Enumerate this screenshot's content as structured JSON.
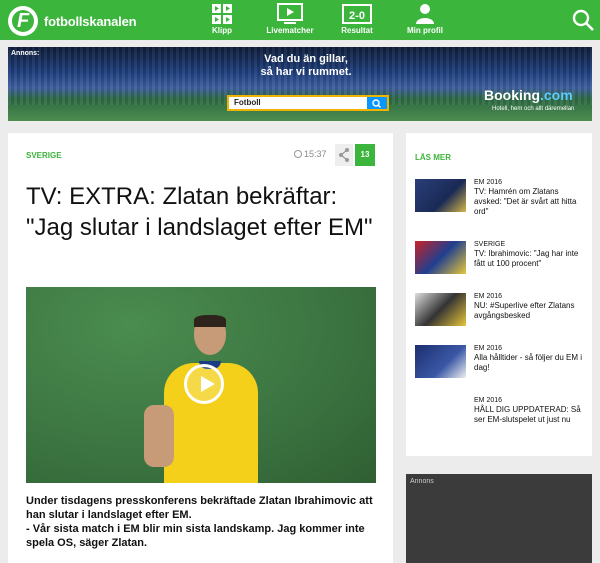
{
  "header": {
    "logo_text": "fotbollskanalen",
    "nav": [
      {
        "label": "Klipp",
        "icon": "grid-icon"
      },
      {
        "label": "Livematcher",
        "icon": "tv-icon"
      },
      {
        "label": "Resultat",
        "icon": "scoreboard-icon"
      },
      {
        "label": "Min profil",
        "icon": "user-icon"
      }
    ],
    "scoreboard_text": "2-0",
    "search_icon": "search-icon",
    "color_brand": "#3bb53b"
  },
  "ad_banner": {
    "label": "Annons:",
    "tagline_line1": "Vad du än gillar,",
    "tagline_line2": "så har vi rummet.",
    "search_value": "Fotboll",
    "brand_main": "Booking",
    "brand_suffix": ".com",
    "brand_sub": "Hotell, hem och allt däremellan"
  },
  "article": {
    "category": "SVERIGE",
    "time": "15:37",
    "share_count": "13",
    "headline": "TV: EXTRA: Zlatan bekräftar: \"Jag slutar i landslaget efter EM\"",
    "lead_p1": "Under tisdagens presskonferens bekräftade Zlatan Ibrahimovic att han slutar i landslaget efter EM.",
    "lead_p2": "- Vår sista match i EM blir min sista landskamp. Jag kommer inte spela OS, säger Zlatan."
  },
  "sidebar": {
    "heading": "LÄS MER",
    "items": [
      {
        "category": "EM 2016",
        "title": "TV: Hamrén om Zlatans avsked: \"Det är svårt att hitta ord\""
      },
      {
        "category": "SVERIGE",
        "title": "TV: Ibrahimovic: \"Jag har inte fått ut 100 procent\""
      },
      {
        "category": "EM 2016",
        "title": "NU: #Superlive efter Zlatans avgångsbesked"
      },
      {
        "category": "EM 2016",
        "title": "Alla hålltider - så följer du EM i dag!"
      },
      {
        "category": "EM 2016",
        "title": "HÅLL DIG UPPDATERAD: Så ser EM-slutspelet ut just nu"
      }
    ],
    "ad_label": "Annons"
  }
}
